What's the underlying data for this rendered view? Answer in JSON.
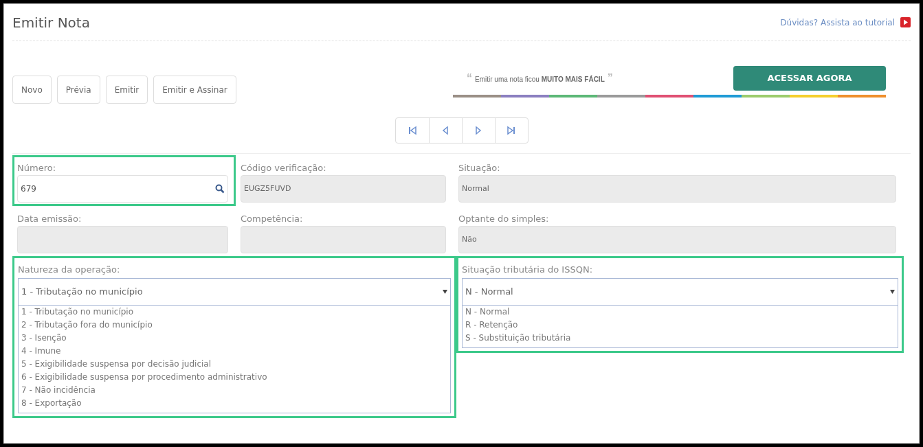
{
  "header": {
    "title": "Emitir Nota",
    "help_link": "Dúvidas? Assista ao tutorial"
  },
  "toolbar": {
    "buttons": [
      "Novo",
      "Prévia",
      "Emitir",
      "Emitir e Assinar"
    ]
  },
  "promo": {
    "open_quote": "“",
    "text": "Emitir uma nota ficou **MUITO MAIS FÁCIL**",
    "close_quote": "”",
    "button": "ACESSAR AGORA"
  },
  "pager": [
    {
      "kind": "first"
    },
    {
      "kind": "previous"
    },
    {
      "kind": "next"
    },
    {
      "kind": "last"
    }
  ],
  "fields": [
    {
      "label": "Número:",
      "value": "679",
      "kind": "search",
      "highlighted": true
    },
    {
      "label": "Código verificação:",
      "value": "EUGZ5FUVD",
      "kind": "readonly",
      "highlighted": false
    },
    {
      "label": "Situação:",
      "value": "Normal",
      "kind": "readonly",
      "highlighted": false
    },
    {
      "label": "Data emissão:",
      "kind": "readonly",
      "highlighted": false
    },
    {
      "label": "Competência:",
      "kind": "readonly",
      "highlighted": false
    },
    {
      "label": "Optante do simples:",
      "value": "Não",
      "kind": "readonly",
      "highlighted": false
    }
  ],
  "selects": [
    {
      "label": "Natureza da operação:",
      "value": "1 - Tributação no município",
      "expanded": true,
      "highlighted": true,
      "options": [
        "1 - Tributação no município",
        "2 - Tributação fora do município",
        "3 - Isenção",
        "4 - Imune",
        "5 - Exigibilidade suspensa por decisão judicial",
        "6 - Exigibilidade suspensa por procedimento administrativo",
        "7 - Não incidência",
        "8 - Exportação"
      ]
    },
    {
      "label": "Situação tributária do ISSQN:",
      "value": "N - Normal",
      "expanded": true,
      "highlighted": true,
      "options": [
        "N - Normal",
        "R - Retenção",
        "S - Substituição tributária"
      ]
    }
  ]
}
